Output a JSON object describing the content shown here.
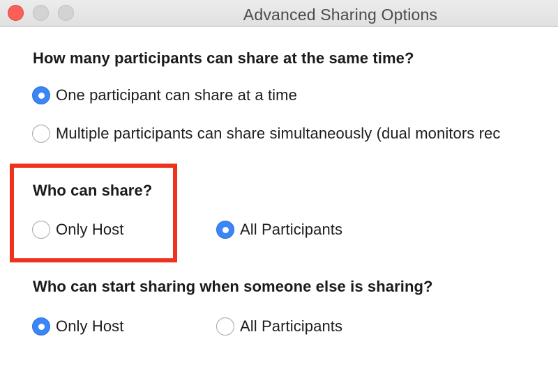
{
  "window": {
    "title": "Advanced Sharing Options"
  },
  "sections": [
    {
      "question": "How many participants can share at the same time?",
      "options": [
        {
          "label": "One participant can share at a time",
          "selected": true
        },
        {
          "label": "Multiple participants can share simultaneously (dual monitors rec",
          "selected": false
        }
      ]
    },
    {
      "question": "Who can share?",
      "options": [
        {
          "label": "Only Host",
          "selected": false
        },
        {
          "label": "All Participants",
          "selected": true
        }
      ]
    },
    {
      "question": "Who can start sharing when someone else is sharing?",
      "options": [
        {
          "label": "Only Host",
          "selected": true
        },
        {
          "label": "All Participants",
          "selected": false
        }
      ]
    }
  ],
  "highlight": {
    "color": "#f0311d",
    "target": "Who can share?"
  },
  "colors": {
    "radio_selected": "#3a86f7",
    "close_button": "#fc5f57"
  }
}
